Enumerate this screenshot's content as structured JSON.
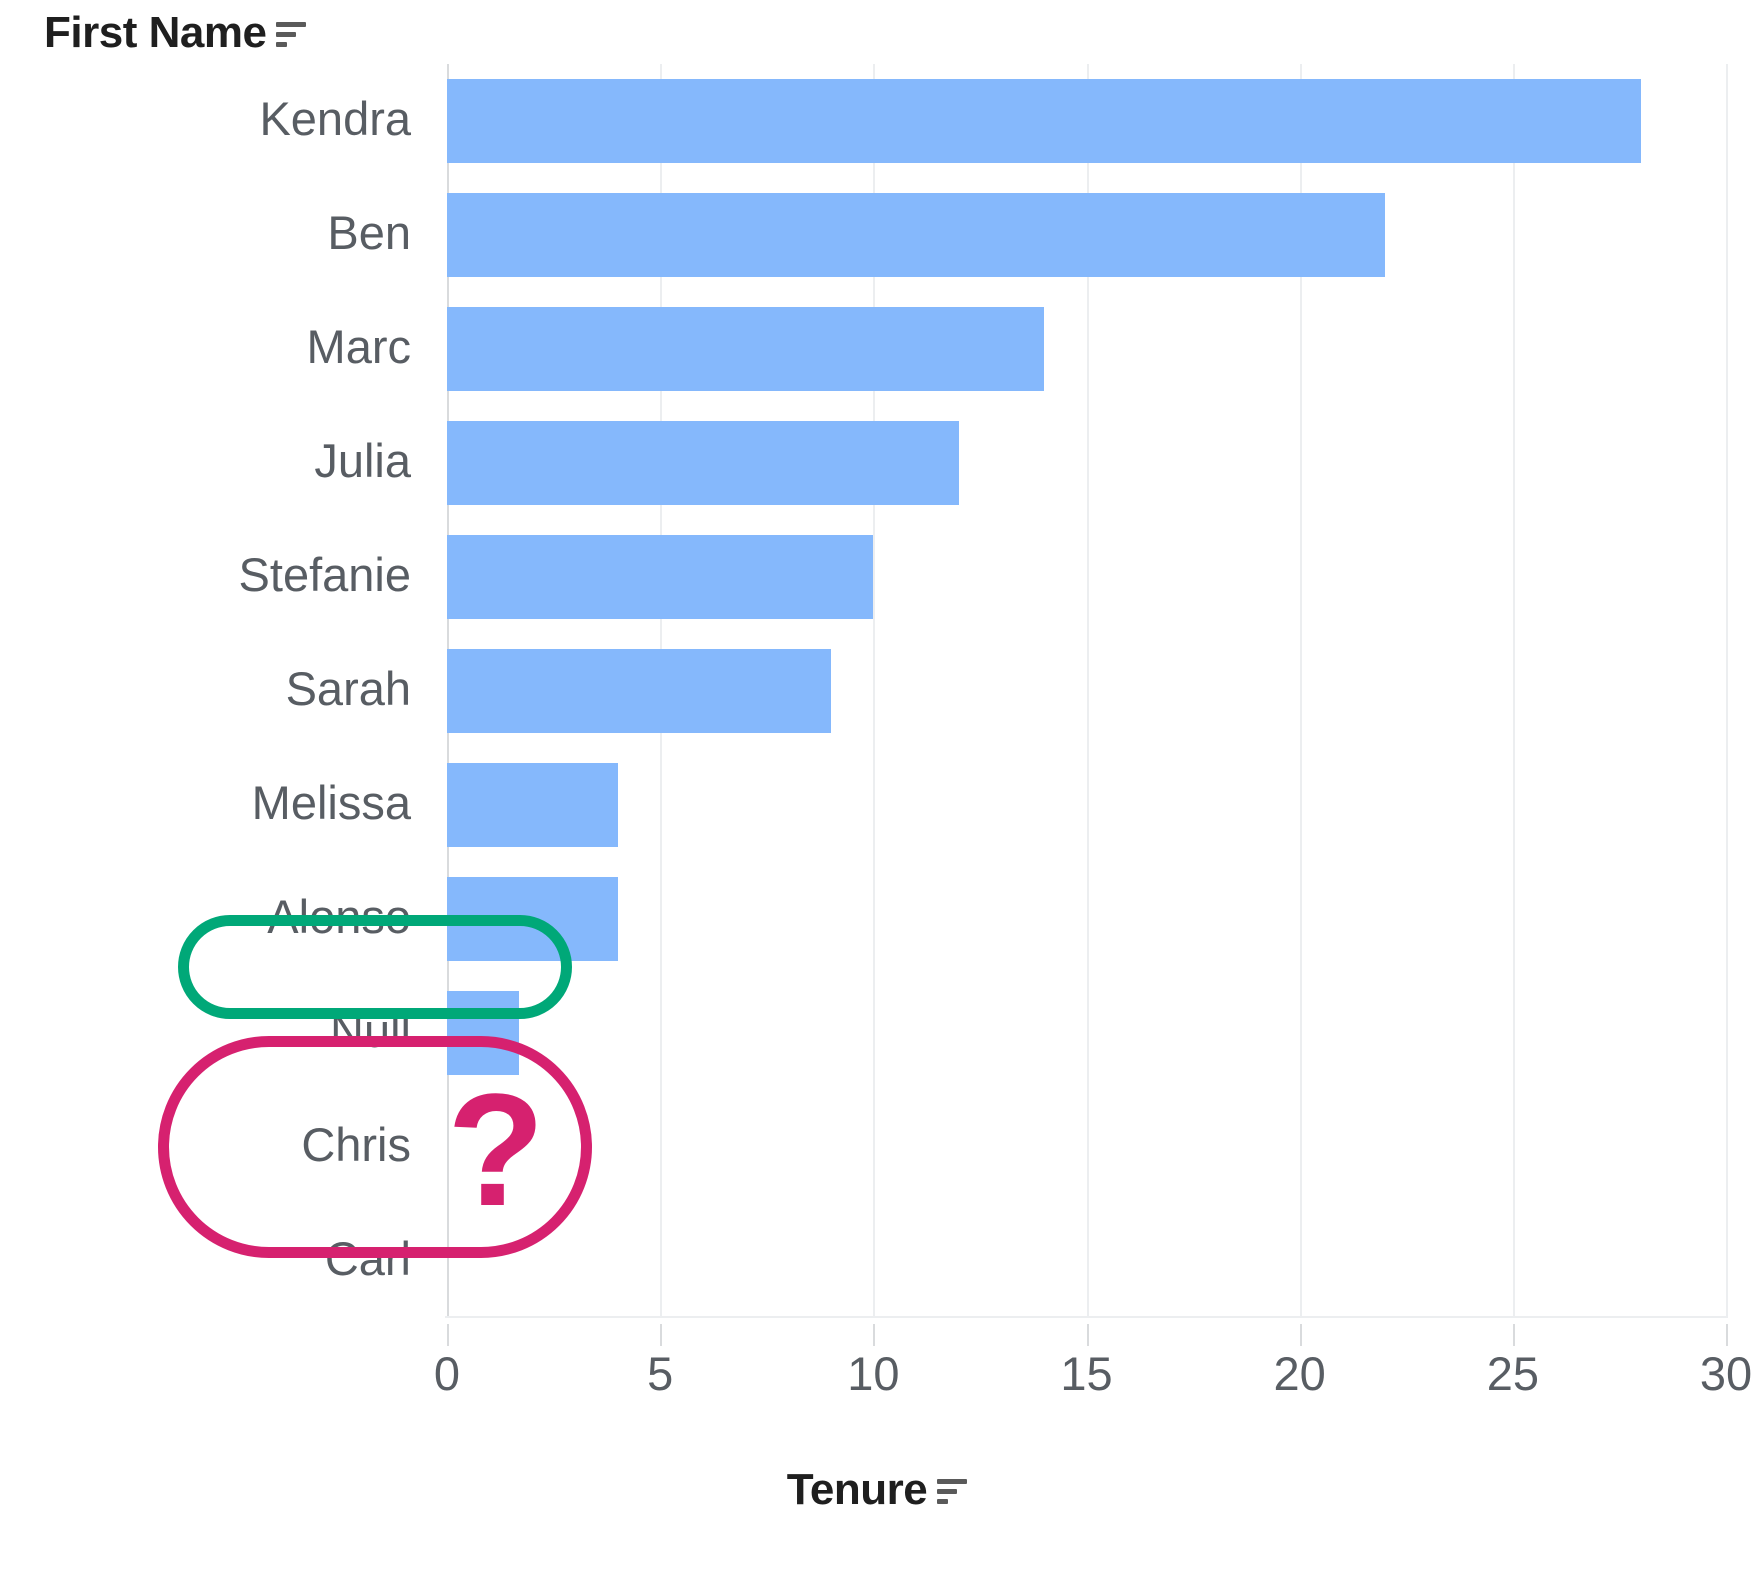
{
  "row_field": {
    "label": "First Name",
    "sort_icon": "sort-descending-icon"
  },
  "axis_title": {
    "label": "Tenure",
    "sort_icon": "sort-descending-icon"
  },
  "annotations": {
    "null_highlight": {
      "color": "#00a878",
      "target_label": "Null",
      "shape": "rounded-rectangle"
    },
    "missing_highlight": {
      "color": "#d6216f",
      "target_labels": "Chris, Carl",
      "shape": "rounded-rectangle",
      "marker": "?"
    }
  },
  "colors": {
    "bar": "#85b8fc",
    "grid": "#eceef0",
    "text": "#585d63",
    "heading": "#1f1f1f",
    "green_annotation": "#00a878",
    "pink_annotation": "#d6216f"
  },
  "chart_data": {
    "type": "bar",
    "orientation": "horizontal",
    "title": "",
    "xlabel": "Tenure",
    "ylabel": "First Name",
    "xlim": [
      0,
      30
    ],
    "xticks": [
      0,
      5,
      10,
      15,
      20,
      25,
      30
    ],
    "xtick_labels": [
      "0",
      "5",
      "10",
      "15",
      "20",
      "25",
      "30"
    ],
    "grid": true,
    "legend": "none",
    "categories": [
      "Kendra",
      "Ben",
      "Marc",
      "Julia",
      "Stefanie",
      "Sarah",
      "Melissa",
      "Alonso",
      "Null",
      "Chris",
      "Carl"
    ],
    "values": [
      28,
      22,
      14,
      12,
      10,
      9,
      4,
      4,
      1.7,
      null,
      null
    ],
    "notes": "Chris and Carl have no bar drawn (missing values). Null category has a small bar of about 1.7."
  }
}
